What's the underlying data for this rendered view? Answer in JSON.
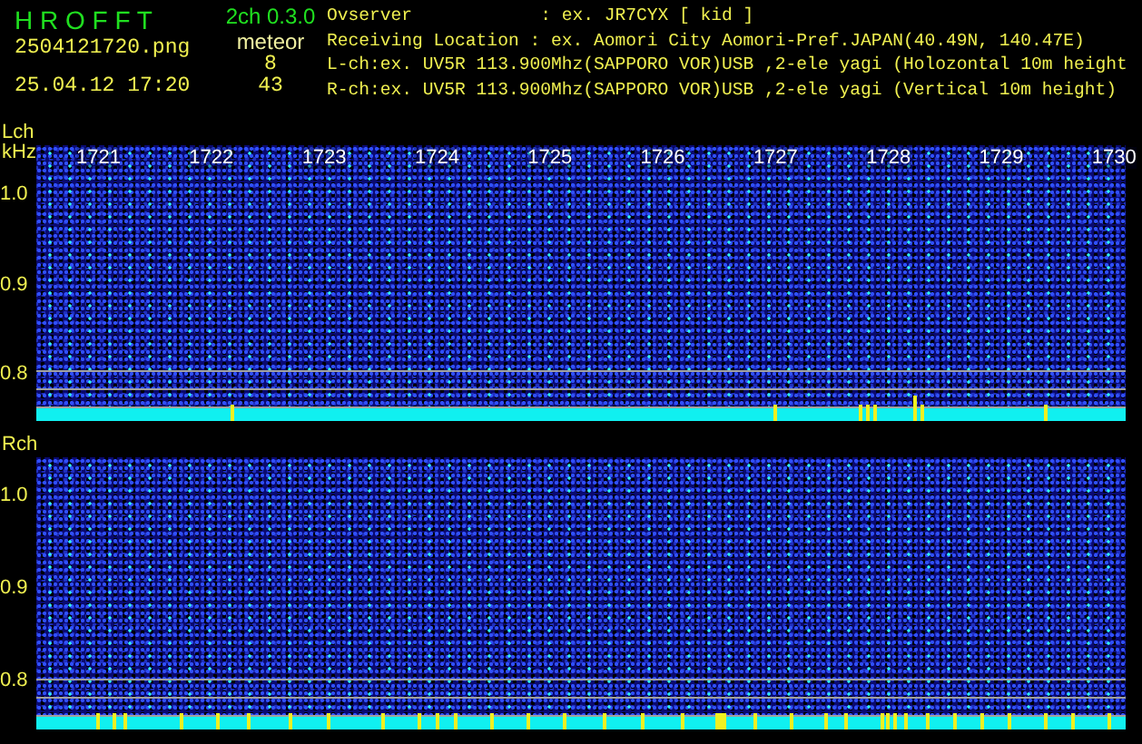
{
  "app": {
    "title": "H R O F F T",
    "version": "2ch 0.3.0",
    "filename": "2504121720.png",
    "timestamp": "25.04.12 17:20"
  },
  "meteor": {
    "label": "meteor",
    "counts": [
      "8",
      "43"
    ]
  },
  "info_lines": [
    "Ovserver            : ex. JR7CYX [ kid ]",
    "Receiving Location : ex. Aomori City Aomori-Pref.JAPAN(40.49N, 140.47E)",
    "L-ch:ex. UV5R 113.900Mhz(SAPPORO VOR)USB ,2-ele yagi (Holozontal 10m height",
    "R-ch:ex. UV5R 113.900Mhz(SAPPORO VOR)USB ,2-ele yagi (Vertical 10m height)"
  ],
  "panels": [
    {
      "channel": "Lch",
      "unit": "kHz",
      "freq_labels": [
        "1721",
        "1722",
        "1723",
        "1724",
        "1725",
        "1726",
        "1727",
        "1728",
        "1729",
        "1730"
      ],
      "y_labels": [
        "1.0",
        "0.9",
        "0.8"
      ]
    },
    {
      "channel": "Rch",
      "y_labels": [
        "1.0",
        "0.9",
        "0.8"
      ]
    }
  ]
}
